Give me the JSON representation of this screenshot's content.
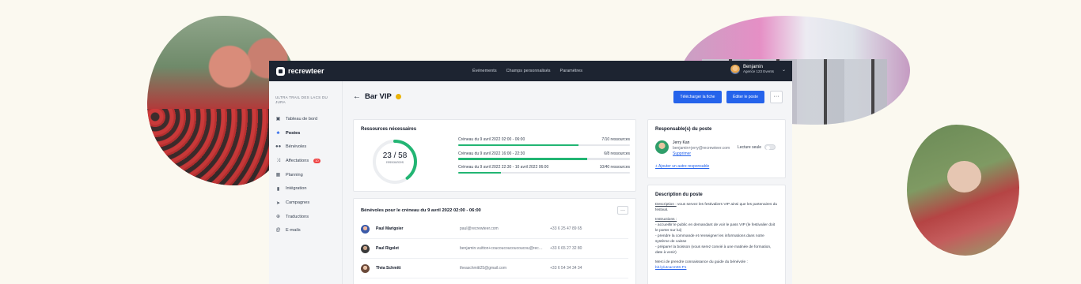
{
  "app": {
    "brand": "recrewteer",
    "nav": [
      "Événements",
      "Champs personnalisés",
      "Paramètres"
    ],
    "user": {
      "name": "Benjamin",
      "org": "Agence 123 Events"
    }
  },
  "sidebar": {
    "event_name": "ULTRA TRAIL DES LACS DU JURA",
    "items": [
      {
        "label": "Tableau de bord",
        "icon": "dashboard-icon"
      },
      {
        "label": "Postes",
        "icon": "org-chart-icon",
        "active": true
      },
      {
        "label": "Bénévoles",
        "icon": "users-icon"
      },
      {
        "label": "Affectations",
        "icon": "shuffle-icon",
        "badge": "10"
      },
      {
        "label": "Planning",
        "icon": "calendar-icon"
      },
      {
        "label": "Intégration",
        "icon": "door-icon"
      },
      {
        "label": "Campagnes",
        "icon": "send-icon"
      },
      {
        "label": "Traductions",
        "icon": "globe-icon"
      },
      {
        "label": "E-mails",
        "icon": "at-icon"
      }
    ]
  },
  "page": {
    "title": "Bar VIP",
    "status_color": "#eab308",
    "download_label": "Télécharger la fiche",
    "edit_label": "Éditer le poste",
    "more_label": "···"
  },
  "resources": {
    "title": "Ressources nécessaires",
    "donut_value": "23 / 58",
    "donut_fraction": 0.397,
    "donut_label": "ressources",
    "slots": [
      {
        "label": "Créneau du 9 avril 2022 02:00 - 06:00",
        "count": "7/10 ressources",
        "fill": 0.7
      },
      {
        "label": "Créneau du 9 avril 2022 16:00 - 22:30",
        "count": "6/8 ressources",
        "fill": 0.75
      },
      {
        "label": "Créneau du 9 avril 2022 22:30 - 10 avril 2022 06:00",
        "count": "10/40 ressources",
        "fill": 0.25
      }
    ]
  },
  "volunteers": {
    "title": "Bénévoles pour le créneau du 9 avril 2022 02:00 - 06:00",
    "more_label": "···",
    "rows": [
      {
        "name": "Paul Marigoier",
        "email": "paul@recrewteer.com",
        "phone": "+33 6 25 47 89 65"
      },
      {
        "name": "Paul Rigolet",
        "email": "benjamin.vuitton+coucoucoucoucoucou@recrewteer.com",
        "phone": "+33 6 65 27 32 80"
      },
      {
        "name": "Théa Schmitt",
        "email": "theaschmitt25@gmail.com",
        "phone": "+33 6 54 34 34 34"
      }
    ]
  },
  "responsible": {
    "title": "Responsable(s) du poste",
    "name": "Jerry Kan",
    "email": "benjamin+jerry@recrewteer.com",
    "remove_label": "Supprimer",
    "readonly_label": "Lecture seule",
    "add_label": "+ Ajouter un autre responsable"
  },
  "description": {
    "title": "Description du poste",
    "desc_label": "Description :",
    "desc_text": " vous servez les festivaliers VIP ainsi que les partenaires du festival.",
    "instructions_label": "Instructions :",
    "instructions": [
      "- accueillir le public en demandant de voir le pass VIP (le festivalier doit le porter sur lui)",
      "- prendre la commande et renseigner les informations dans notre système de caisse",
      "- préparer la boisson (vous serez convié à une matinée de formation, date à venir)"
    ],
    "guide_text": "Merci de prendre connaissance du guide du bénévole :",
    "guide_link": "bit.ly/utcacm06-P1"
  }
}
